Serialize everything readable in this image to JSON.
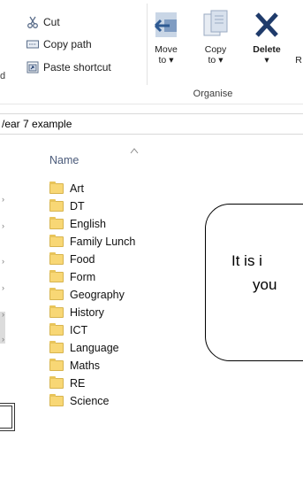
{
  "ribbon": {
    "clipboard": {
      "items": [
        {
          "label": "Cut",
          "icon": "scissors-icon"
        },
        {
          "label": "Copy path",
          "icon": "copy-path-icon"
        },
        {
          "label": "Paste shortcut",
          "icon": "paste-shortcut-icon"
        }
      ],
      "group_label": "d"
    },
    "organise": {
      "buttons": [
        {
          "label": "Move",
          "sub": "to ▾",
          "icon": "move-to-icon"
        },
        {
          "label": "Copy",
          "sub": "to ▾",
          "icon": "copy-to-icon"
        },
        {
          "label": "Delete",
          "sub": "▾",
          "icon": "delete-icon"
        }
      ],
      "rename_fragment": "R",
      "group_label": "Organise"
    }
  },
  "address": {
    "path": "/ear 7 example"
  },
  "file_list": {
    "column_header": "Name",
    "items": [
      "Art",
      "DT",
      "English",
      "Family Lunch",
      "Food",
      "Form",
      "Geography",
      "History",
      "ICT",
      "Language",
      "Maths",
      "RE",
      "Science"
    ]
  },
  "callout": {
    "line1": "It is i",
    "line2": "you"
  },
  "colors": {
    "folder": "#f8d775",
    "accent_blue": "#2b7cd3",
    "delete_blue": "#1f3b6b"
  }
}
